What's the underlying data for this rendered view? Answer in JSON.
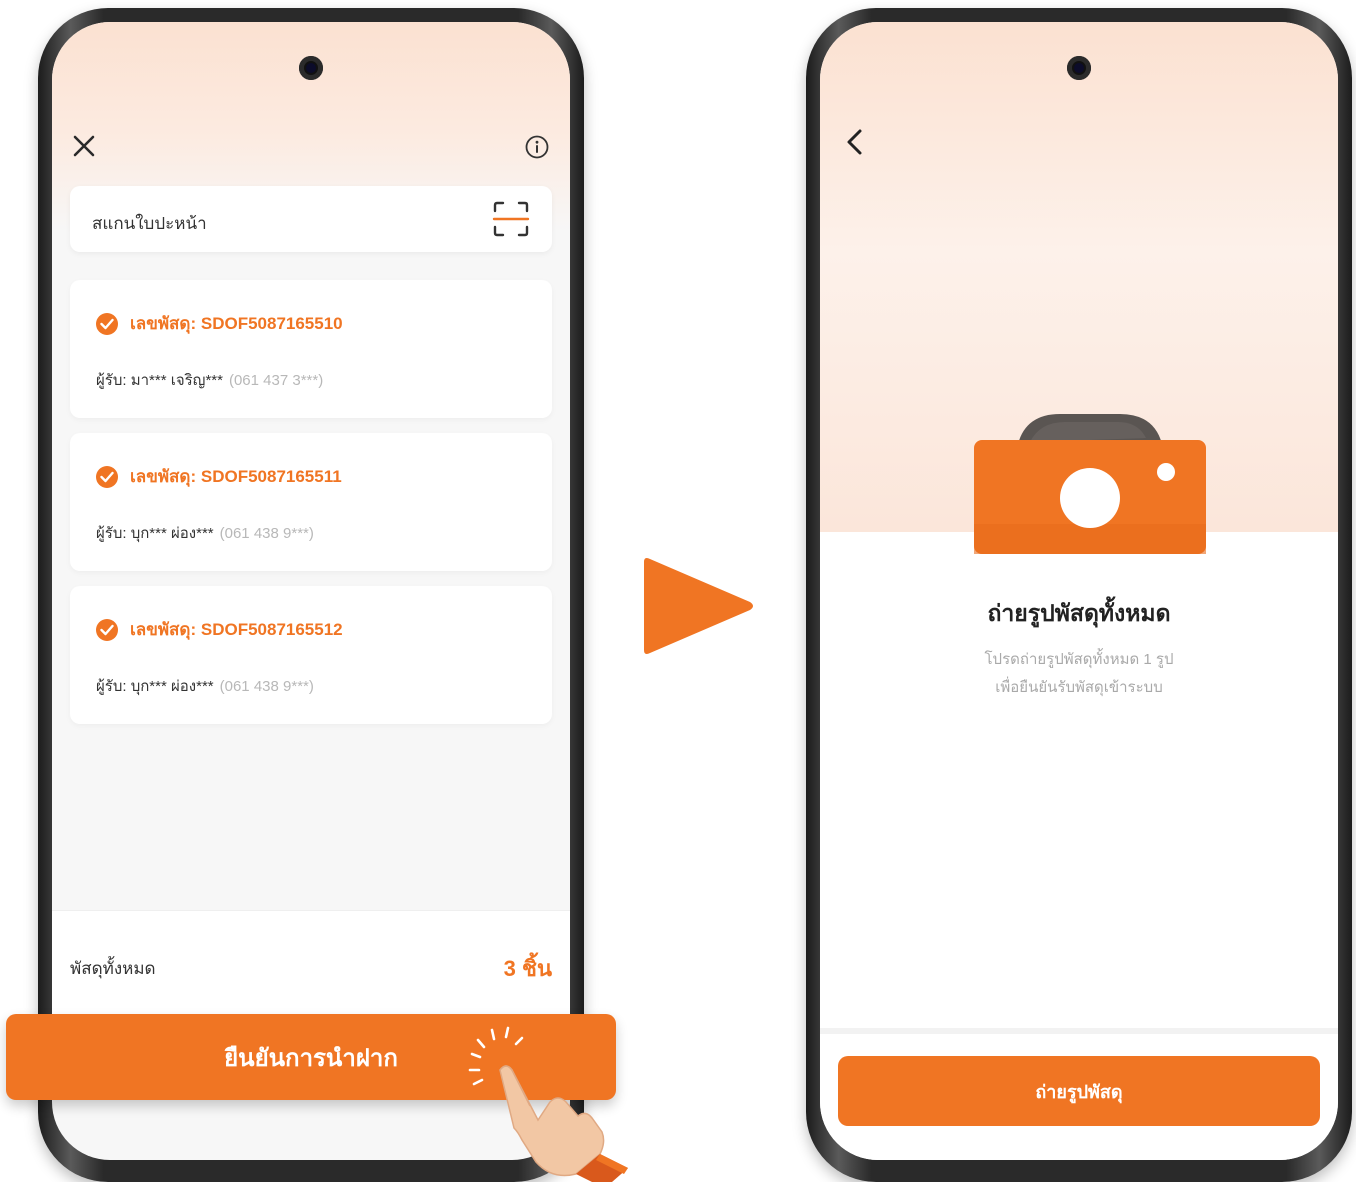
{
  "left_screen": {
    "scan_placeholder": "สแกนใบปะหน้า",
    "parcels": [
      {
        "id_label": "เลขพัสดุ: SDOF5087165510",
        "recipient": "ผู้รับ: มา*** เจริญ***",
        "phone": "(061 437 3***)"
      },
      {
        "id_label": "เลขพัสดุ: SDOF5087165511",
        "recipient": "ผู้รับ: บุก*** ผ่อง***",
        "phone": "(061 438 9***)"
      },
      {
        "id_label": "เลขพัสดุ: SDOF5087165512",
        "recipient": "ผู้รับ: บุก*** ผ่อง***",
        "phone": "(061 438 9***)"
      }
    ],
    "total_label": "พัสดุทั้งหมด",
    "total_count": "3 ชิ้น",
    "confirm_button": "ยืนยันการนำฝาก"
  },
  "right_screen": {
    "title": "ถ่ายรูปพัสดุทั้งหมด",
    "description_line1": "โปรดถ่ายรูปพัสดุทั้งหมด 1 รูป",
    "description_line2": "เพื่อยืนยันรับพัสดุเข้าระบบ",
    "take_photo_button": "ถ่ายรูปพัสดุ"
  },
  "colors": {
    "accent": "#f07523",
    "gradient_top": "#fbe1d1",
    "muted_text": "#a9a9a9"
  },
  "icons": [
    "close-icon",
    "info-icon",
    "scan-icon",
    "check-icon",
    "arrow-icon",
    "back-icon",
    "camera-icon",
    "tap-hand-icon"
  ]
}
